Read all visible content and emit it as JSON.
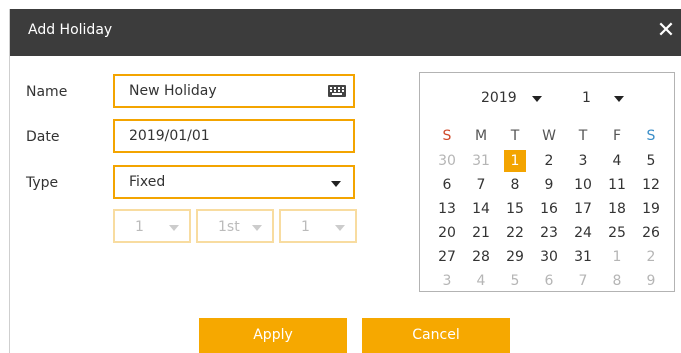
{
  "dialog": {
    "title": "Add Holiday",
    "close_glyph": "✕"
  },
  "form": {
    "name_label": "Name",
    "name_value": "New Holiday",
    "date_label": "Date",
    "date_value": "2019/01/01",
    "type_label": "Type",
    "type_value": "Fixed",
    "sub_month": "1",
    "sub_week": "1st",
    "sub_day": "1"
  },
  "calendar": {
    "year": "2019",
    "month": "1",
    "weekdays": [
      "S",
      "M",
      "T",
      "W",
      "T",
      "F",
      "S"
    ],
    "selected_day": "1",
    "weeks": [
      [
        {
          "d": "30",
          "m": true
        },
        {
          "d": "31",
          "m": true
        },
        {
          "d": "1",
          "sel": true
        },
        {
          "d": "2"
        },
        {
          "d": "3"
        },
        {
          "d": "4"
        },
        {
          "d": "5"
        }
      ],
      [
        {
          "d": "6"
        },
        {
          "d": "7"
        },
        {
          "d": "8"
        },
        {
          "d": "9"
        },
        {
          "d": "10"
        },
        {
          "d": "11"
        },
        {
          "d": "12"
        }
      ],
      [
        {
          "d": "13"
        },
        {
          "d": "14"
        },
        {
          "d": "15"
        },
        {
          "d": "16"
        },
        {
          "d": "17"
        },
        {
          "d": "18"
        },
        {
          "d": "19"
        }
      ],
      [
        {
          "d": "20"
        },
        {
          "d": "21"
        },
        {
          "d": "22"
        },
        {
          "d": "23"
        },
        {
          "d": "24"
        },
        {
          "d": "25"
        },
        {
          "d": "26"
        }
      ],
      [
        {
          "d": "27"
        },
        {
          "d": "28"
        },
        {
          "d": "29"
        },
        {
          "d": "30"
        },
        {
          "d": "31"
        },
        {
          "d": "1",
          "m": true
        },
        {
          "d": "2",
          "m": true
        }
      ],
      [
        {
          "d": "3",
          "m": true
        },
        {
          "d": "4",
          "m": true
        },
        {
          "d": "5",
          "m": true
        },
        {
          "d": "6",
          "m": true
        },
        {
          "d": "7",
          "m": true
        },
        {
          "d": "8",
          "m": true
        },
        {
          "d": "9",
          "m": true
        }
      ]
    ]
  },
  "buttons": {
    "apply": "Apply",
    "cancel": "Cancel"
  },
  "colors": {
    "accent": "#f6a800",
    "titlebar": "#3c3c3c",
    "sunday": "#d04a2a",
    "saturday": "#3a8ec8"
  },
  "icons": {
    "keyboard": "keyboard-icon",
    "close": "close-icon",
    "dropdown": "chevron-down-icon"
  }
}
